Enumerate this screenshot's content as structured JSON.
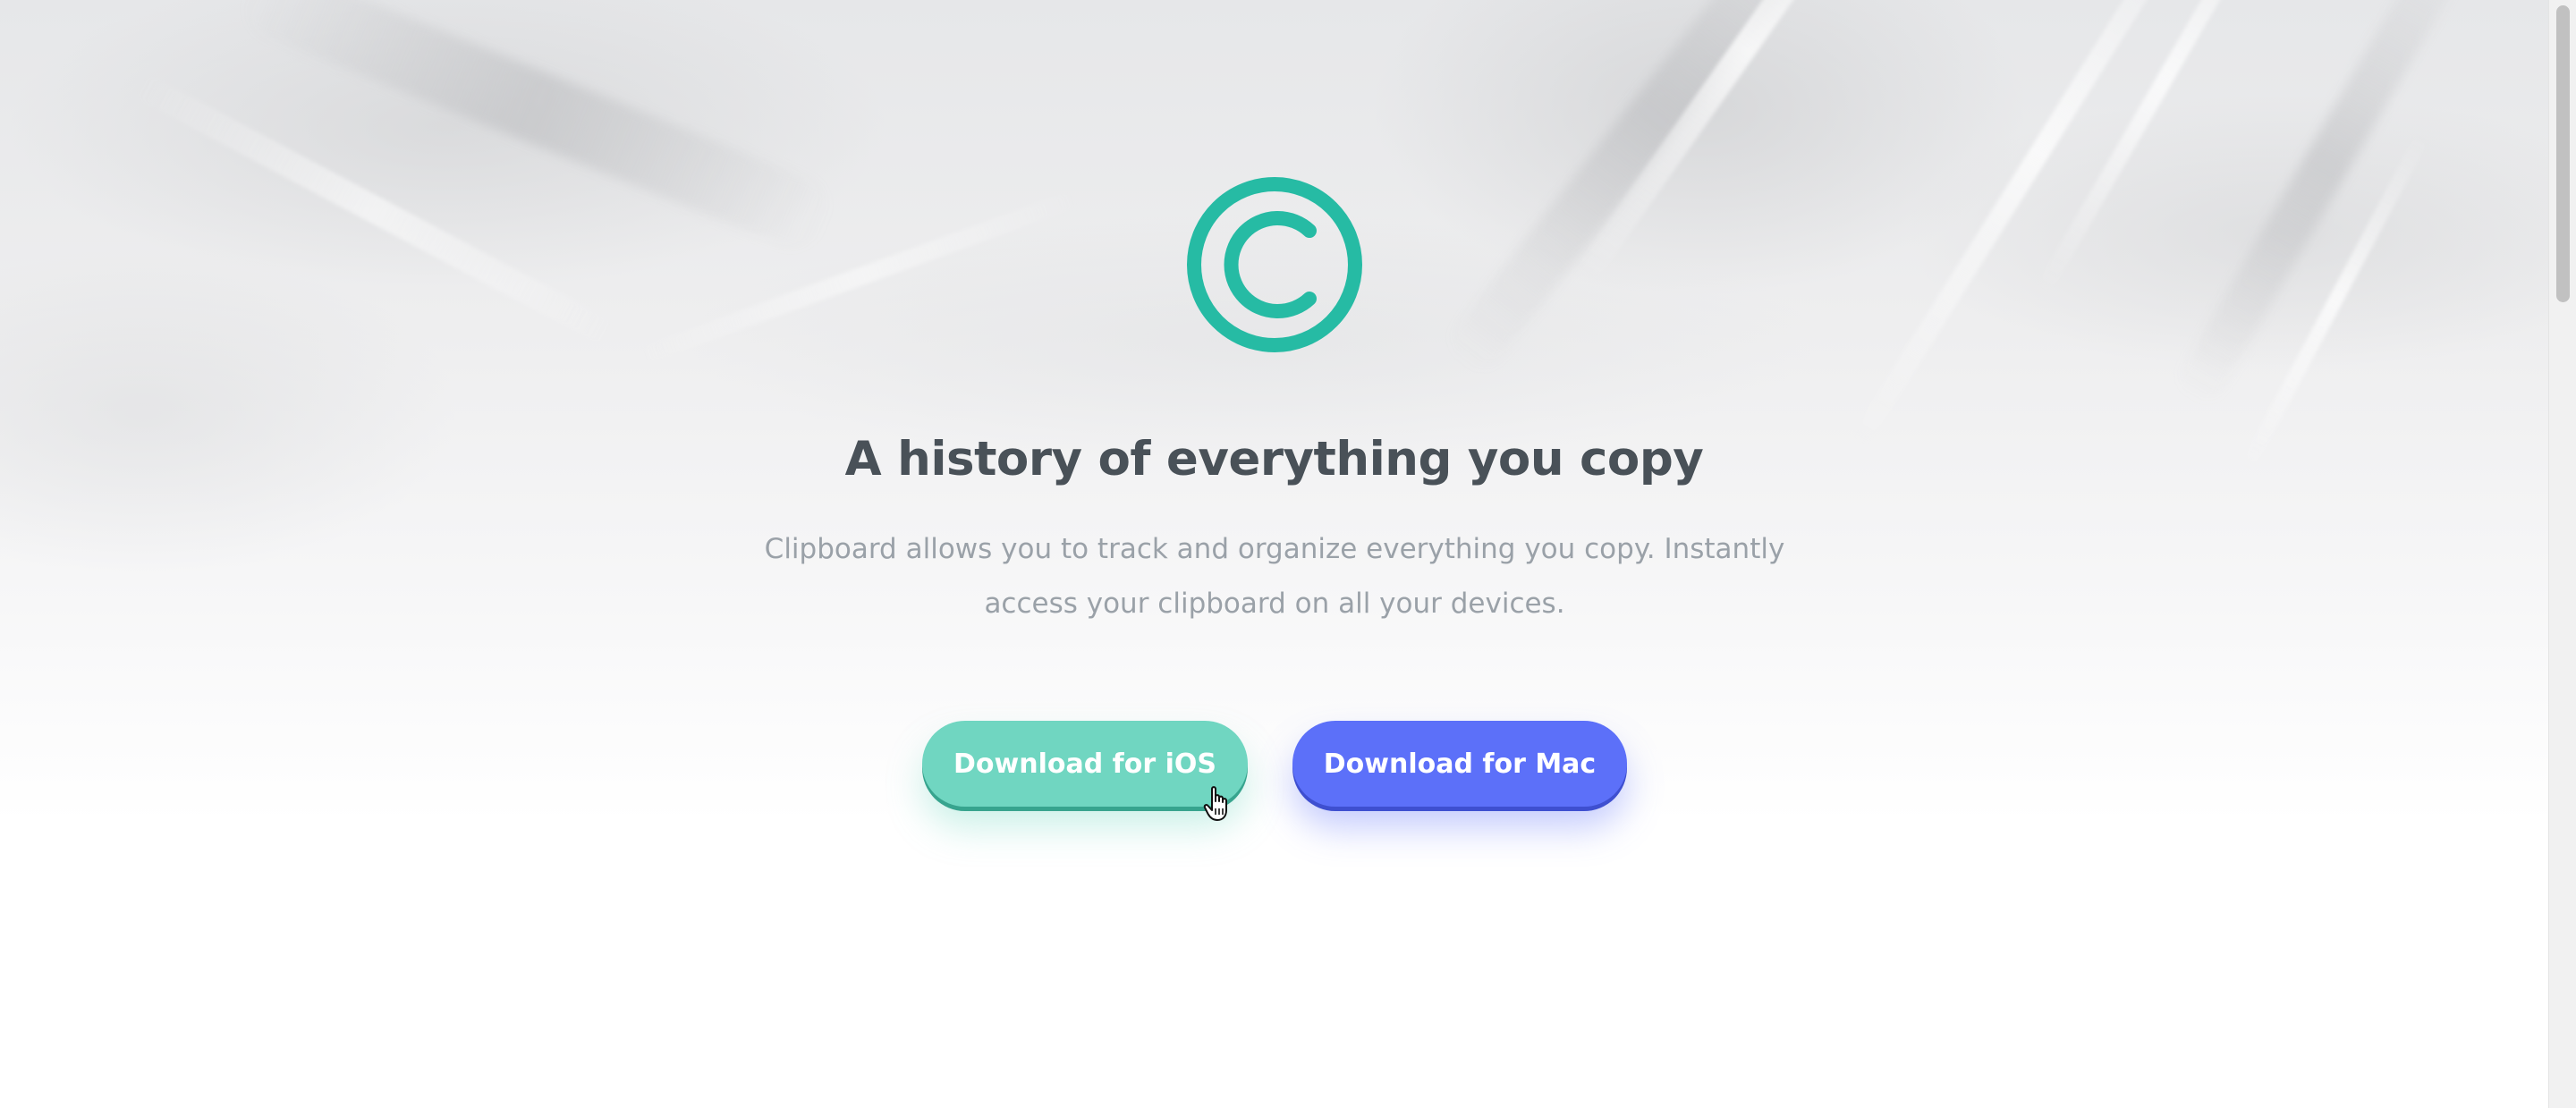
{
  "hero": {
    "title": "A history of everything you copy",
    "subtitle": "Clipboard allows you to track and organize everything you copy. Instantly access your clipboard on all your devices.",
    "logo_icon": "copyright-c-logo-icon"
  },
  "buttons": {
    "ios_label": "Download for iOS",
    "mac_label": "Download for Mac"
  },
  "colors": {
    "accent_teal": "#26bba4",
    "ios_button": "#70d6c1",
    "mac_button": "#5c70f9",
    "title_text": "#495158",
    "subtitle_text": "#9aa1a8"
  },
  "cursor": {
    "icon": "hand-pointer-cursor-icon"
  }
}
